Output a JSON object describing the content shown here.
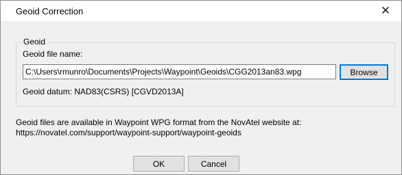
{
  "window": {
    "title": "Geoid Correction",
    "close_glyph": "✕"
  },
  "geoid_group": {
    "legend": "Geoid",
    "file_label": "Geoid file name:",
    "file_value": "C:\\Users\\rmunro\\Documents\\Projects\\Waypoint\\Geoids\\CGG2013an83.wpg",
    "browse_label": "Browse",
    "datum_text": "Geoid datum: NAD83(CSRS) [CGVD2013A]"
  },
  "info": {
    "line1": "Geoid files are available in Waypoint WPG format from the NovAtel website at:",
    "line2": "https://novatel.com/support/waypoint-support/waypoint-geoids"
  },
  "buttons": {
    "ok": "OK",
    "cancel": "Cancel"
  },
  "icons": {
    "close": "close-icon"
  },
  "colors": {
    "dialog_bg": "#f0f0f0",
    "focus_border": "#0078d7"
  }
}
